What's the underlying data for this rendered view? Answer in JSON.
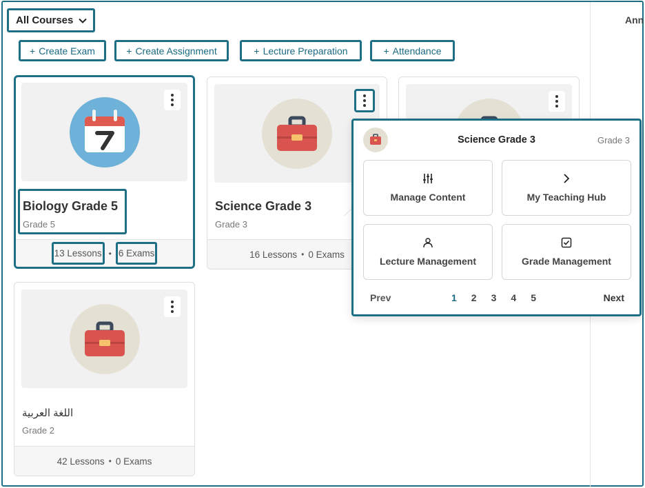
{
  "header": {
    "course_filter": "All Courses",
    "right_panel_label": "Announcements"
  },
  "quick_actions": [
    {
      "plus": "+",
      "label": "Create Exam"
    },
    {
      "plus": "+",
      "label": "Create Assignment"
    },
    {
      "plus": "+",
      "label": "Lecture Preparation"
    },
    {
      "plus": "+",
      "label": "Attendance"
    }
  ],
  "courses": [
    {
      "title": "Biology Grade 5",
      "grade": "Grade 5",
      "lessons": "13 Lessons",
      "exams": "6 Exams",
      "icon": "calendar-icon",
      "icon_bg": "#6fb2d9"
    },
    {
      "title": "Science Grade 3",
      "grade": "Grade 3",
      "lessons": "16 Lessons",
      "exams": "0 Exams",
      "icon": "toolbox-icon",
      "icon_bg": "#e4e1d4"
    },
    {
      "title": "",
      "grade": "",
      "lessons": "",
      "exams": "",
      "icon": "toolbox-icon",
      "icon_bg": "#e4e1d4"
    },
    {
      "title": "اللغة العربية",
      "grade": "Grade 2",
      "lessons": "42 Lessons",
      "exams": "0 Exams",
      "icon": "toolbox-icon",
      "icon_bg": "#e4e1d4"
    }
  ],
  "footer_separator": "•",
  "popup": {
    "title": "Science Grade 3",
    "grade": "Grade 3",
    "tiles": [
      {
        "label": "Manage Content",
        "icon": "sliders-icon"
      },
      {
        "label": "My Teaching Hub",
        "icon": "chevron-right-icon"
      },
      {
        "label": "Lecture Management",
        "icon": "user-icon"
      },
      {
        "label": "Grade Management",
        "icon": "checkbox-icon"
      }
    ],
    "pager": {
      "prev": "Prev",
      "pages": [
        "1",
        "2",
        "3",
        "4",
        "5"
      ],
      "current": "1",
      "next": "Next"
    }
  },
  "colors": {
    "accent": "#1e6f85",
    "link": "#1a6a82",
    "toolbox_red": "#d9534f"
  }
}
